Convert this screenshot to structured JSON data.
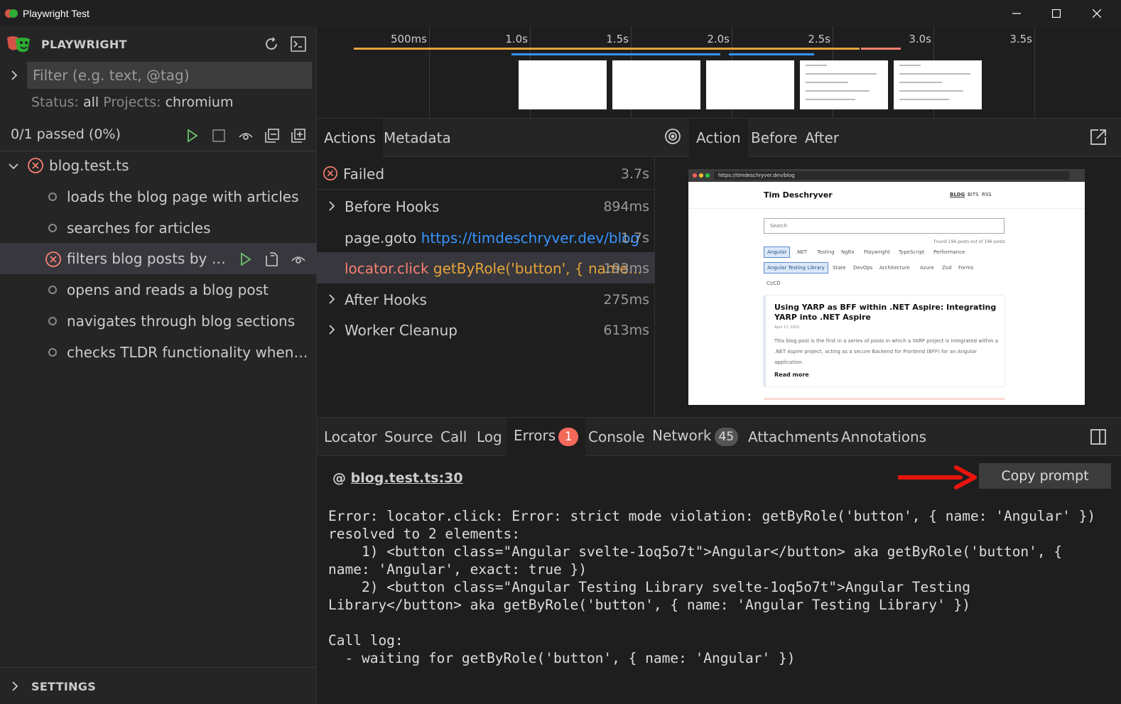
{
  "window": {
    "title": "Playwright Test"
  },
  "sidebar": {
    "brand": "PLAYWRIGHT",
    "filter_placeholder": "Filter (e.g. text, @tag)",
    "status_label": "Status:",
    "status_value": "all",
    "projects_label": "Projects:",
    "projects_value": "chromium",
    "passed_summary": "0/1 passed (0%)",
    "file": "blog.test.ts",
    "tests": [
      {
        "name": "loads the blog page with articles",
        "status": "pending"
      },
      {
        "name": "searches for articles",
        "status": "pending"
      },
      {
        "name": "filters blog posts by tag",
        "status": "failed"
      },
      {
        "name": "opens and reads a blog post",
        "status": "pending"
      },
      {
        "name": "navigates through blog sections",
        "status": "pending"
      },
      {
        "name": "checks TLDR functionality when available",
        "status": "pending"
      }
    ],
    "settings": "SETTINGS"
  },
  "timeline": {
    "ticks": [
      "500ms",
      "1.0s",
      "1.5s",
      "2.0s",
      "2.5s",
      "3.0s",
      "3.5s"
    ]
  },
  "actions_panel": {
    "tabs": [
      "Actions",
      "Metadata"
    ],
    "failed": {
      "label": "Failed",
      "duration": "3.7s"
    },
    "rows": [
      {
        "label": "Before Hooks",
        "duration": "894ms",
        "expandable": true
      },
      {
        "label": "page.goto",
        "arg": "https://timdeschryver.dev/blog",
        "duration": "1.7s"
      },
      {
        "label": "locator.click",
        "arg": "getByRole('button', { name...",
        "duration": "193ms"
      },
      {
        "label": "After Hooks",
        "duration": "275ms",
        "expandable": true
      },
      {
        "label": "Worker Cleanup",
        "duration": "613ms",
        "expandable": true
      }
    ]
  },
  "snapshot_panel": {
    "tabs": [
      "Action",
      "Before",
      "After"
    ],
    "browser": {
      "url": "https://timdeschryver.dev/blog",
      "site_title": "Tim Deschryver",
      "nav": [
        "BLOG",
        "BITS",
        "RSS"
      ],
      "search_placeholder": "Search",
      "found": "Found 196 posts out of 196 posts",
      "tags_row1": [
        "Angular",
        ".NET",
        "Testing",
        "NgRx",
        "Playwright",
        "TypeScript",
        "Performance"
      ],
      "tags_row2": [
        "Angular Testing Library",
        "State",
        "DevOps",
        "Architecture",
        "Azure",
        "Zod",
        "Forms"
      ],
      "tags_row3": [
        "CI/CD"
      ],
      "post": {
        "title": "Using YARP as BFF within .NET Aspire: Integrating YARP into .NET Aspire",
        "date": "April 17, 2025",
        "excerpt": "This blog post is the first in a series of posts in which a YARP project is integrated within a .NET Aspire project, acting as a secure Backend for Frontend (BFF) for an Angular application.",
        "read_more": "Read more"
      }
    }
  },
  "bottom_panel": {
    "tabs": [
      {
        "label": "Locator"
      },
      {
        "label": "Source"
      },
      {
        "label": "Call"
      },
      {
        "label": "Log"
      },
      {
        "label": "Errors",
        "badge": "1"
      },
      {
        "label": "Console"
      },
      {
        "label": "Network",
        "badge": "45"
      },
      {
        "label": "Attachments"
      },
      {
        "label": "Annotations"
      }
    ],
    "source_prefix": "@",
    "source_link": "blog.test.ts:30",
    "copy_prompt": "Copy prompt",
    "error_text": "Error: locator.click: Error: strict mode violation: getByRole('button', { name: 'Angular' }) resolved to 2 elements:\n    1) <button class=\"Angular svelte-1oq5o7t\">Angular</button> aka getByRole('button', { name: 'Angular', exact: true })\n    2) <button class=\"Angular Testing Library svelte-1oq5o7t\">Angular Testing Library</button> aka getByRole('button', { name: 'Angular Testing Library' })\n\nCall log:\n  - waiting for getByRole('button', { name: 'Angular' })"
  },
  "colors": {
    "error": "#f88070",
    "warning": "#e5a33a",
    "link": "#3794ff",
    "success": "#6cc36a",
    "badge_red": "#f4695a"
  }
}
